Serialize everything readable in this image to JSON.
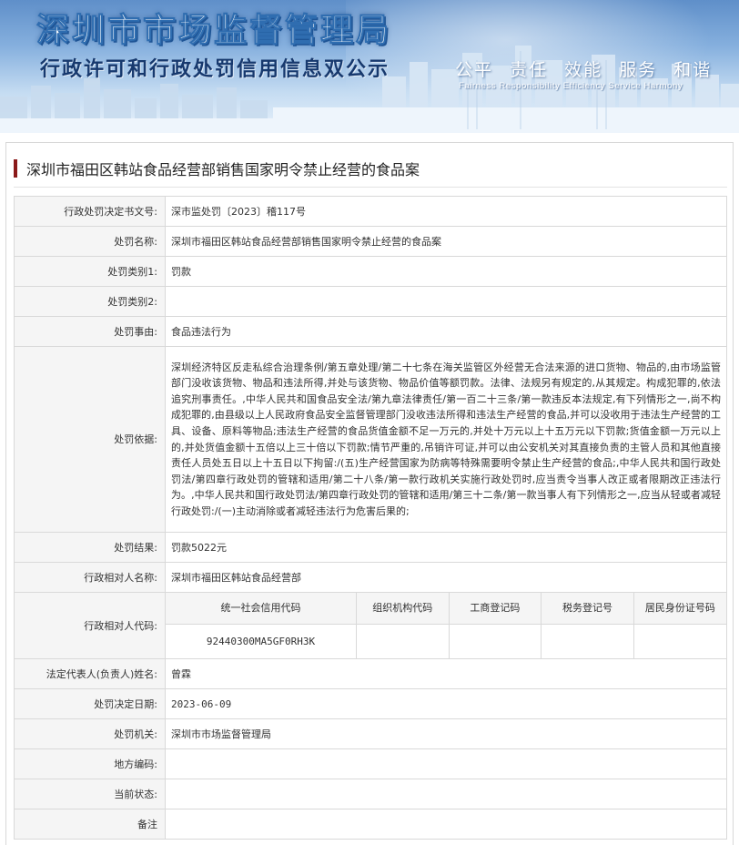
{
  "banner": {
    "title": "深圳市市场监督管理局",
    "subtitle": "行政许可和行政处罚信用信息双公示",
    "slogan_cn": "公平 责任 效能 服务 和谐",
    "slogan_en": "Fairness Responsibility Efficiency Service Harmony"
  },
  "case": {
    "title": "深圳市福田区韩站食品经营部销售国家明令禁止经营的食品案"
  },
  "labels": {
    "decision_no": "行政处罚决定书文号:",
    "penalty_name": "处罚名称:",
    "category1": "处罚类别1:",
    "category2": "处罚类别2:",
    "cause": "处罚事由:",
    "basis": "处罚依据:",
    "result": "处罚结果:",
    "party_name": "行政相对人名称:",
    "party_code": "行政相对人代码:",
    "legal_rep": "法定代表人(负责人)姓名:",
    "decision_date": "处罚决定日期:",
    "authority": "处罚机关:",
    "area_code": "地方编码:",
    "status": "当前状态:",
    "remarks": "备注"
  },
  "values": {
    "decision_no": "深市监处罚〔2023〕稽117号",
    "penalty_name": "深圳市福田区韩站食品经营部销售国家明令禁止经营的食品案",
    "category1": "罚款",
    "category2": "",
    "cause": "食品违法行为",
    "basis": "深圳经济特区反走私综合治理条例/第五章处理/第二十七条在海关监管区外经营无合法来源的进口货物、物品的,由市场监管部门没收该货物、物品和违法所得,并处与该货物、物品价值等额罚款。法律、法规另有规定的,从其规定。构成犯罪的,依法追究刑事责任。,中华人民共和国食品安全法/第九章法律责任/第一百二十三条/第一款违反本法规定,有下列情形之一,尚不构成犯罪的,由县级以上人民政府食品安全监督管理部门没收违法所得和违法生产经营的食品,并可以没收用于违法生产经营的工具、设备、原料等物品;违法生产经营的食品货值金额不足一万元的,并处十万元以上十五万元以下罚款;货值金额一万元以上的,并处货值金额十五倍以上三十倍以下罚款;情节严重的,吊销许可证,并可以由公安机关对其直接负责的主管人员和其他直接责任人员处五日以上十五日以下拘留:/(五)生产经营国家为防病等特殊需要明令禁止生产经营的食品;,中华人民共和国行政处罚法/第四章行政处罚的管辖和适用/第二十八条/第一款行政机关实施行政处罚时,应当责令当事人改正或者限期改正违法行为。,中华人民共和国行政处罚法/第四章行政处罚的管辖和适用/第三十二条/第一款当事人有下列情形之一,应当从轻或者减轻行政处罚:/(一)主动消除或者减轻违法行为危害后果的;",
    "result": "罚款5022元",
    "party_name": "深圳市福田区韩站食品经营部",
    "legal_rep": "曾霖",
    "decision_date": "2023-06-09",
    "authority": "深圳市市场监督管理局",
    "area_code": "",
    "status": "",
    "remarks": ""
  },
  "party_codes": {
    "headers": [
      "统一社会信用代码",
      "组织机构代码",
      "工商登记码",
      "税务登记号",
      "居民身份证号码"
    ],
    "values": [
      "92440300MA5GF0RH3K",
      "",
      "",
      "",
      ""
    ]
  },
  "colors": {
    "title_bar": "#8b1a1a",
    "label_bg": "#f5f5f5",
    "border": "#d9d9d9"
  }
}
